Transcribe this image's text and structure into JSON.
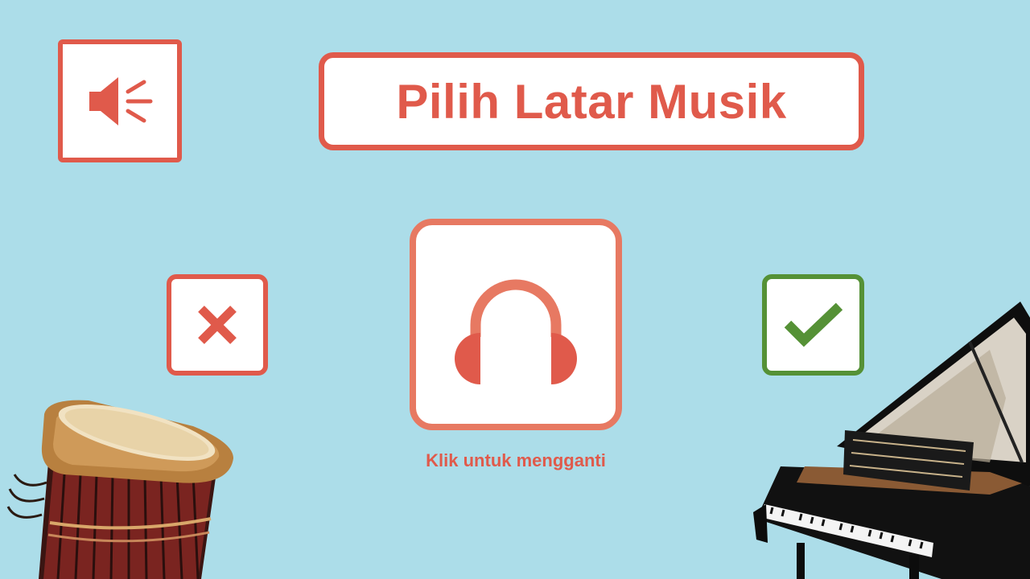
{
  "app": {
    "title": "Pilih Latar Musik",
    "hint": "Klik untuk mengganti"
  },
  "controls": {
    "sound_toggle_icon": "speaker-icon",
    "cancel_icon": "close-icon",
    "confirm_icon": "check-icon",
    "music_select_icon": "headphones-icon"
  },
  "decorations": {
    "left_image": "djembe-drum",
    "right_image": "grand-piano"
  },
  "colors": {
    "background": "#acdde9",
    "accent": "#e05a4b",
    "accent_soft": "#e77962",
    "confirm": "#559136"
  }
}
